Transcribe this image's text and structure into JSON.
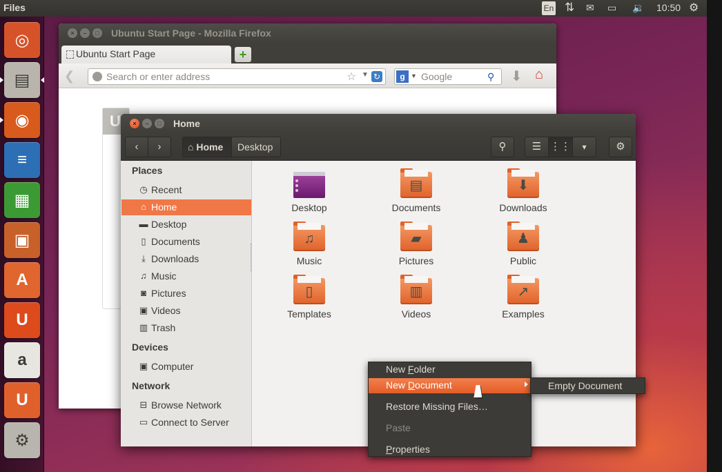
{
  "top_panel": {
    "app_title": "Files",
    "keyboard_layout": "En",
    "time": "10:50"
  },
  "launcher": {
    "items": [
      {
        "name": "dash-home",
        "icon": "ubuntu-logo-icon",
        "color": "#d6532a"
      },
      {
        "name": "files",
        "icon": "file-cabinet-icon",
        "color": "#b9b5ad"
      },
      {
        "name": "firefox",
        "icon": "firefox-icon",
        "color": "#d85a1c"
      },
      {
        "name": "libreoffice-writer",
        "icon": "writer-icon",
        "color": "#2c6fb5"
      },
      {
        "name": "libreoffice-calc",
        "icon": "calc-icon",
        "color": "#3c9a35"
      },
      {
        "name": "libreoffice-impress",
        "icon": "impress-icon",
        "color": "#c8602a"
      },
      {
        "name": "ubuntu-software-center",
        "icon": "software-center-icon",
        "color": "#e0652e"
      },
      {
        "name": "ubuntu-one",
        "icon": "ubuntu-one-icon",
        "color": "#dd4a1c"
      },
      {
        "name": "amazon",
        "icon": "amazon-icon",
        "color": "#e8e6e1"
      },
      {
        "name": "ubuntu-one-music",
        "icon": "ubuntu-one-music-icon",
        "color": "#e0602c"
      },
      {
        "name": "system-settings",
        "icon": "settings-icon",
        "color": "#b8b5ae"
      }
    ]
  },
  "firefox": {
    "window_title": "Ubuntu Start Page - Mozilla Firefox",
    "tab_label": "Ubuntu Start Page",
    "url_placeholder": "Search or enter address",
    "search_engine": "Google",
    "panel_letter": "U"
  },
  "nautilus": {
    "window_title": "Home",
    "breadcrumb": {
      "home": "Home",
      "desktop": "Desktop"
    },
    "sidebar": {
      "sections": [
        {
          "heading": "Places",
          "items": [
            {
              "label": "Recent",
              "icon": "clock-icon"
            },
            {
              "label": "Home",
              "icon": "home-icon",
              "active": true
            },
            {
              "label": "Desktop",
              "icon": "folder-icon"
            },
            {
              "label": "Documents",
              "icon": "document-icon"
            },
            {
              "label": "Downloads",
              "icon": "download-icon"
            },
            {
              "label": "Music",
              "icon": "music-note-icon"
            },
            {
              "label": "Pictures",
              "icon": "camera-icon"
            },
            {
              "label": "Videos",
              "icon": "film-icon"
            },
            {
              "label": "Trash",
              "icon": "trash-icon"
            }
          ]
        },
        {
          "heading": "Devices",
          "items": [
            {
              "label": "Computer",
              "icon": "drive-icon"
            }
          ]
        },
        {
          "heading": "Network",
          "items": [
            {
              "label": "Browse Network",
              "icon": "network-icon"
            },
            {
              "label": "Connect to Server",
              "icon": "server-icon"
            }
          ]
        }
      ]
    },
    "files": [
      {
        "label": "Desktop",
        "icon": "desktop-folder-icon"
      },
      {
        "label": "Documents",
        "icon": "documents-folder-icon"
      },
      {
        "label": "Downloads",
        "icon": "downloads-folder-icon"
      },
      {
        "label": "Music",
        "icon": "music-folder-icon"
      },
      {
        "label": "Pictures",
        "icon": "pictures-folder-icon"
      },
      {
        "label": "Public",
        "icon": "public-folder-icon"
      },
      {
        "label": "Templates",
        "icon": "templates-folder-icon"
      },
      {
        "label": "Videos",
        "icon": "videos-folder-icon"
      },
      {
        "label": "Examples",
        "icon": "examples-folder-icon"
      }
    ]
  },
  "context_menu": {
    "items": [
      {
        "pre": "New ",
        "u": "F",
        "post": "older",
        "state": "normal"
      },
      {
        "pre": "New ",
        "u": "D",
        "post": "ocument",
        "state": "highlighted",
        "submenu": true
      },
      {
        "pre": "Restore Missing Files…",
        "u": "",
        "post": "",
        "state": "normal"
      },
      {
        "pre": "Paste",
        "u": "",
        "post": "",
        "state": "disabled"
      },
      {
        "pre": "",
        "u": "P",
        "post": "roperties",
        "state": "normal"
      }
    ],
    "submenu_item": "Empty Document"
  }
}
